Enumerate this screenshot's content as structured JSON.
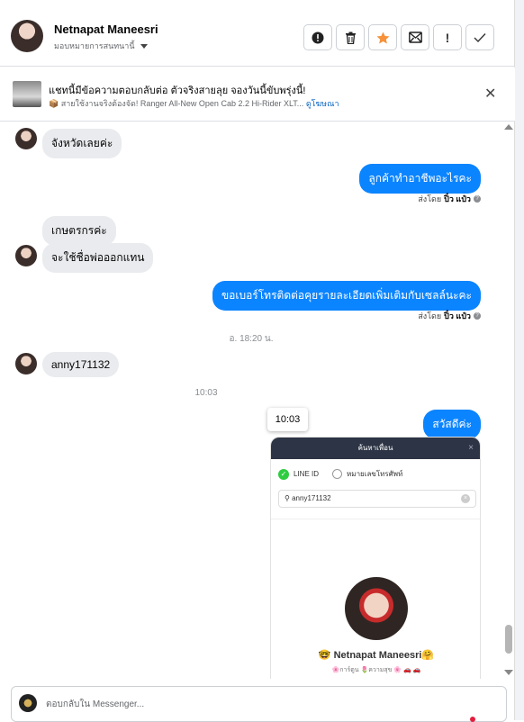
{
  "header": {
    "name": "Netnapat Maneesri",
    "assign_label": "มอบหมายการสนทนานี้",
    "tool_icons": [
      "alert-icon",
      "trash-icon",
      "star-icon",
      "mail-icon",
      "exclamation-icon",
      "check-icon"
    ],
    "tool_glyphs": [
      "⓿",
      "🗑",
      "★",
      "✉",
      "!",
      "✓"
    ]
  },
  "ad": {
    "title": "แชทนี้มีข้อความตอบกลับต่อ ตัวจริงสายลุย จองวันนี้ขับพรุ่งนี้!",
    "subtitle": "📦 สายใช้งานจริงต้องจัด! Ranger All-New Open Cab 2.2 Hi-Rider XLT...",
    "link": "ดูโฆษณา"
  },
  "messages": [
    {
      "dir": "in",
      "text": "จังหวัดเลยค่ะ"
    },
    {
      "dir": "out",
      "text": "ลูกค้าทำอาชีพอะไรคะ",
      "sent_by_label": "ส่งโดย",
      "sender": "ปิ๋ว แป๋ว"
    },
    {
      "dir": "in",
      "text": "เกษตรกรค่ะ"
    },
    {
      "dir": "in",
      "text": "จะใช้ชื่อพ่อออกแทน"
    },
    {
      "dir": "out",
      "text": "ขอเบอร์โทรติดต่อคุยรายละเอียดเพิ่มเติมกับเซลล์นะคะ",
      "sent_by_label": "ส่งโดย",
      "sender": "ปิ๋ว แป๋ว"
    },
    {
      "dir": "in",
      "text": "anny171132"
    },
    {
      "dir": "out",
      "text": "สวัสดีค่ะ"
    }
  ],
  "timestamps": [
    "อ. 18:20 น.",
    "10:03"
  ],
  "tooltip": "10:03",
  "attachment": {
    "title": "ค้นหาเพื่อน",
    "close": "×",
    "option_line_id": "LINE ID",
    "option_phone": "หมายเลขโทรศัพท์",
    "search_value": "anny171132",
    "profile_name": "🤓 Netnapat Maneesri🤗",
    "profile_tags": "🌸การ์ตูน 🌷ความสุข 🌸 🚗 🚗"
  },
  "composer": {
    "placeholder": "ตอบกลับใน Messenger..."
  }
}
